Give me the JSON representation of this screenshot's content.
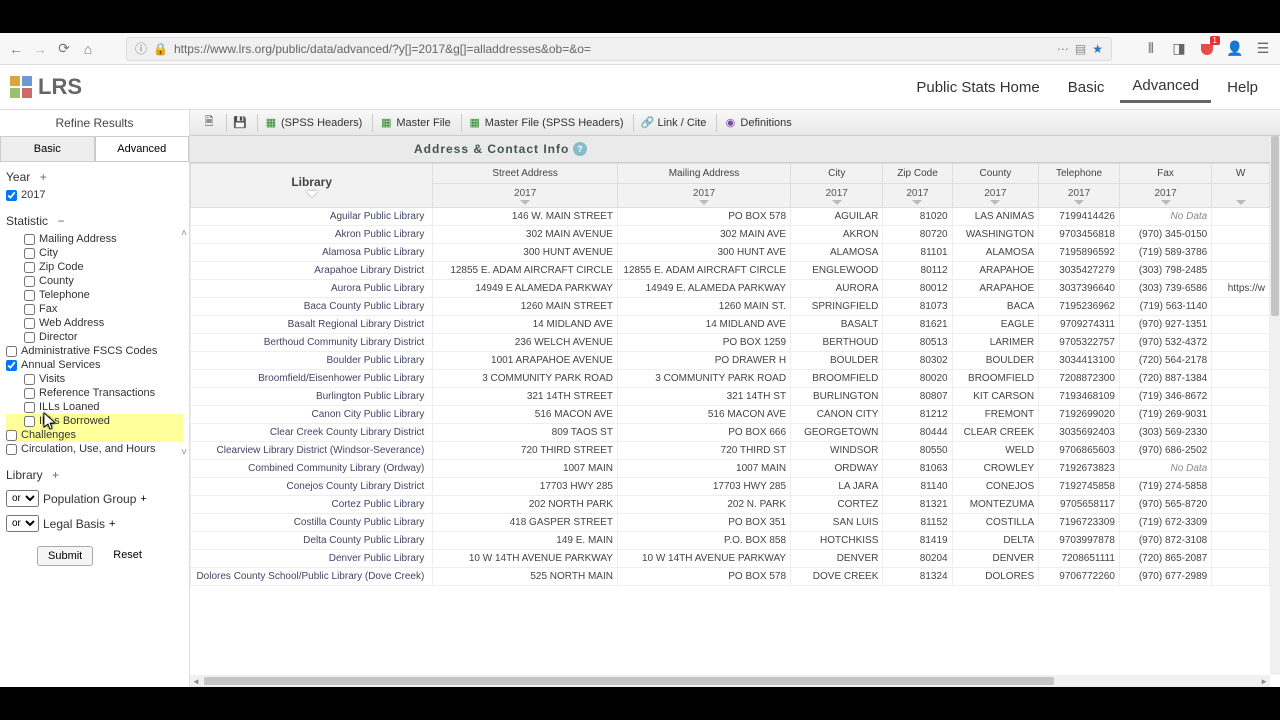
{
  "url": "https://www.lrs.org/public/data/advanced/?y[]=2017&g[]=alladdresses&ob=&o=",
  "pocket_badge": "1",
  "logo": "LRS",
  "header_links": {
    "home": "Public Stats Home",
    "basic": "Basic",
    "advanced": "Advanced",
    "help": "Help"
  },
  "sidebar": {
    "title": "Refine Results",
    "tabs": {
      "basic": "Basic",
      "advanced": "Advanced"
    },
    "year": {
      "label": "Year",
      "y2017": "2017"
    },
    "statistic": {
      "label": "Statistic"
    },
    "stat_items": [
      {
        "label": "Mailing Address",
        "checked": false,
        "indent": 1
      },
      {
        "label": "City",
        "checked": false,
        "indent": 1
      },
      {
        "label": "Zip Code",
        "checked": false,
        "indent": 1
      },
      {
        "label": "County",
        "checked": false,
        "indent": 1
      },
      {
        "label": "Telephone",
        "checked": false,
        "indent": 1
      },
      {
        "label": "Fax",
        "checked": false,
        "indent": 1
      },
      {
        "label": "Web Address",
        "checked": false,
        "indent": 1
      },
      {
        "label": "Director",
        "checked": false,
        "indent": 1
      },
      {
        "label": "Administrative FSCS Codes",
        "checked": false,
        "indent": 0
      },
      {
        "label": "Annual Services",
        "checked": true,
        "indent": 0
      },
      {
        "label": "Visits",
        "checked": false,
        "indent": 1
      },
      {
        "label": "Reference Transactions",
        "checked": false,
        "indent": 1
      },
      {
        "label": "ILLs Loaned",
        "checked": false,
        "indent": 1
      },
      {
        "label": "ILLs Borrowed",
        "checked": false,
        "indent": 1,
        "highlight": true
      },
      {
        "label": "Challenges",
        "checked": false,
        "indent": 0,
        "highlight": true
      },
      {
        "label": "Circulation, Use, and Hours",
        "checked": false,
        "indent": 0
      }
    ],
    "library": {
      "label": "Library"
    },
    "pop_group": {
      "or": "or",
      "label": "Population Group"
    },
    "legal_basis": {
      "or": "or",
      "label": "Legal Basis"
    },
    "submit": "Submit",
    "reset": "Reset"
  },
  "toolbar": {
    "spss": "(SPSS Headers)",
    "master": "Master File",
    "master_spss": "Master File (SPSS Headers)",
    "link": "Link / Cite",
    "defs": "Definitions"
  },
  "section_title": "Address & Contact Info",
  "columns": {
    "library": "Library",
    "street": "Street Address",
    "mailing": "Mailing Address",
    "city": "City",
    "zip": "Zip Code",
    "county": "County",
    "phone": "Telephone",
    "fax": "Fax",
    "web": "W"
  },
  "year_label": "2017",
  "rows": [
    {
      "lib": "Aguilar Public Library",
      "street": "146 W. MAIN STREET",
      "mail": "PO BOX 578",
      "city": "AGUILAR",
      "zip": "81020",
      "county": "LAS ANIMAS",
      "phone": "7199414426",
      "fax": "No Data",
      "web": ""
    },
    {
      "lib": "Akron Public Library",
      "street": "302 MAIN AVENUE",
      "mail": "302 MAIN AVE",
      "city": "AKRON",
      "zip": "80720",
      "county": "WASHINGTON",
      "phone": "9703456818",
      "fax": "(970) 345-0150",
      "web": ""
    },
    {
      "lib": "Alamosa Public Library",
      "street": "300 HUNT AVENUE",
      "mail": "300 HUNT AVE",
      "city": "ALAMOSA",
      "zip": "81101",
      "county": "ALAMOSA",
      "phone": "7195896592",
      "fax": "(719) 589-3786",
      "web": ""
    },
    {
      "lib": "Arapahoe Library District",
      "street": "12855 E. ADAM AIRCRAFT CIRCLE",
      "mail": "12855 E. ADAM AIRCRAFT CIRCLE",
      "city": "ENGLEWOOD",
      "zip": "80112",
      "county": "ARAPAHOE",
      "phone": "3035427279",
      "fax": "(303) 798-2485",
      "web": ""
    },
    {
      "lib": "Aurora Public Library",
      "street": "14949 E ALAMEDA PARKWAY",
      "mail": "14949 E. ALAMEDA PARKWAY",
      "city": "AURORA",
      "zip": "80012",
      "county": "ARAPAHOE",
      "phone": "3037396640",
      "fax": "(303) 739-6586",
      "web": "https://w"
    },
    {
      "lib": "Baca County Public Library",
      "street": "1260 MAIN STREET",
      "mail": "1260 MAIN ST.",
      "city": "SPRINGFIELD",
      "zip": "81073",
      "county": "BACA",
      "phone": "7195236962",
      "fax": "(719) 563-1140",
      "web": ""
    },
    {
      "lib": "Basalt Regional Library District",
      "street": "14 MIDLAND AVE",
      "mail": "14 MIDLAND AVE",
      "city": "BASALT",
      "zip": "81621",
      "county": "EAGLE",
      "phone": "9709274311",
      "fax": "(970) 927-1351",
      "web": ""
    },
    {
      "lib": "Berthoud Community Library District",
      "street": "236 WELCH AVENUE",
      "mail": "PO BOX 1259",
      "city": "BERTHOUD",
      "zip": "80513",
      "county": "LARIMER",
      "phone": "9705322757",
      "fax": "(970) 532-4372",
      "web": ""
    },
    {
      "lib": "Boulder Public Library",
      "street": "1001 ARAPAHOE AVENUE",
      "mail": "PO DRAWER H",
      "city": "BOULDER",
      "zip": "80302",
      "county": "BOULDER",
      "phone": "3034413100",
      "fax": "(720) 564-2178",
      "web": ""
    },
    {
      "lib": "Broomfield/Eisenhower Public Library",
      "street": "3 COMMUNITY PARK ROAD",
      "mail": "3 COMMUNITY PARK ROAD",
      "city": "BROOMFIELD",
      "zip": "80020",
      "county": "BROOMFIELD",
      "phone": "7208872300",
      "fax": "(720) 887-1384",
      "web": ""
    },
    {
      "lib": "Burlington Public Library",
      "street": "321 14TH STREET",
      "mail": "321 14TH ST",
      "city": "BURLINGTON",
      "zip": "80807",
      "county": "KIT CARSON",
      "phone": "7193468109",
      "fax": "(719) 346-8672",
      "web": ""
    },
    {
      "lib": "Canon City Public Library",
      "street": "516 MACON AVE",
      "mail": "516 MACON AVE",
      "city": "CANON CITY",
      "zip": "81212",
      "county": "FREMONT",
      "phone": "7192699020",
      "fax": "(719) 269-9031",
      "web": ""
    },
    {
      "lib": "Clear Creek County Library District",
      "street": "809 TAOS ST",
      "mail": "PO BOX 666",
      "city": "GEORGETOWN",
      "zip": "80444",
      "county": "CLEAR CREEK",
      "phone": "3035692403",
      "fax": "(303) 569-2330",
      "web": ""
    },
    {
      "lib": "Clearview Library District (Windsor-Severance)",
      "street": "720 THIRD STREET",
      "mail": "720 THIRD ST",
      "city": "WINDSOR",
      "zip": "80550",
      "county": "WELD",
      "phone": "9706865603",
      "fax": "(970) 686-2502",
      "web": ""
    },
    {
      "lib": "Combined Community Library (Ordway)",
      "street": "1007 MAIN",
      "mail": "1007 MAIN",
      "city": "ORDWAY",
      "zip": "81063",
      "county": "CROWLEY",
      "phone": "7192673823",
      "fax": "No Data",
      "web": ""
    },
    {
      "lib": "Conejos County Library District",
      "street": "17703 HWY 285",
      "mail": "17703 HWY 285",
      "city": "LA JARA",
      "zip": "81140",
      "county": "CONEJOS",
      "phone": "7192745858",
      "fax": "(719) 274-5858",
      "web": ""
    },
    {
      "lib": "Cortez Public Library",
      "street": "202 NORTH PARK",
      "mail": "202 N. PARK",
      "city": "CORTEZ",
      "zip": "81321",
      "county": "MONTEZUMA",
      "phone": "9705658117",
      "fax": "(970) 565-8720",
      "web": ""
    },
    {
      "lib": "Costilla County Public Library",
      "street": "418 GASPER STREET",
      "mail": "PO BOX 351",
      "city": "SAN LUIS",
      "zip": "81152",
      "county": "COSTILLA",
      "phone": "7196723309",
      "fax": "(719) 672-3309",
      "web": ""
    },
    {
      "lib": "Delta County Public Library",
      "street": "149 E. MAIN",
      "mail": "P.O. BOX 858",
      "city": "HOTCHKISS",
      "zip": "81419",
      "county": "DELTA",
      "phone": "9703997878",
      "fax": "(970) 872-3108",
      "web": ""
    },
    {
      "lib": "Denver Public Library",
      "street": "10 W 14TH AVENUE PARKWAY",
      "mail": "10 W 14TH AVENUE PARKWAY",
      "city": "DENVER",
      "zip": "80204",
      "county": "DENVER",
      "phone": "7208651111",
      "fax": "(720) 865-2087",
      "web": ""
    },
    {
      "lib": "Dolores County School/Public Library (Dove Creek)",
      "street": "525 NORTH MAIN",
      "mail": "PO BOX 578",
      "city": "DOVE CREEK",
      "zip": "81324",
      "county": "DOLORES",
      "phone": "9706772260",
      "fax": "(970) 677-2989",
      "web": ""
    }
  ]
}
